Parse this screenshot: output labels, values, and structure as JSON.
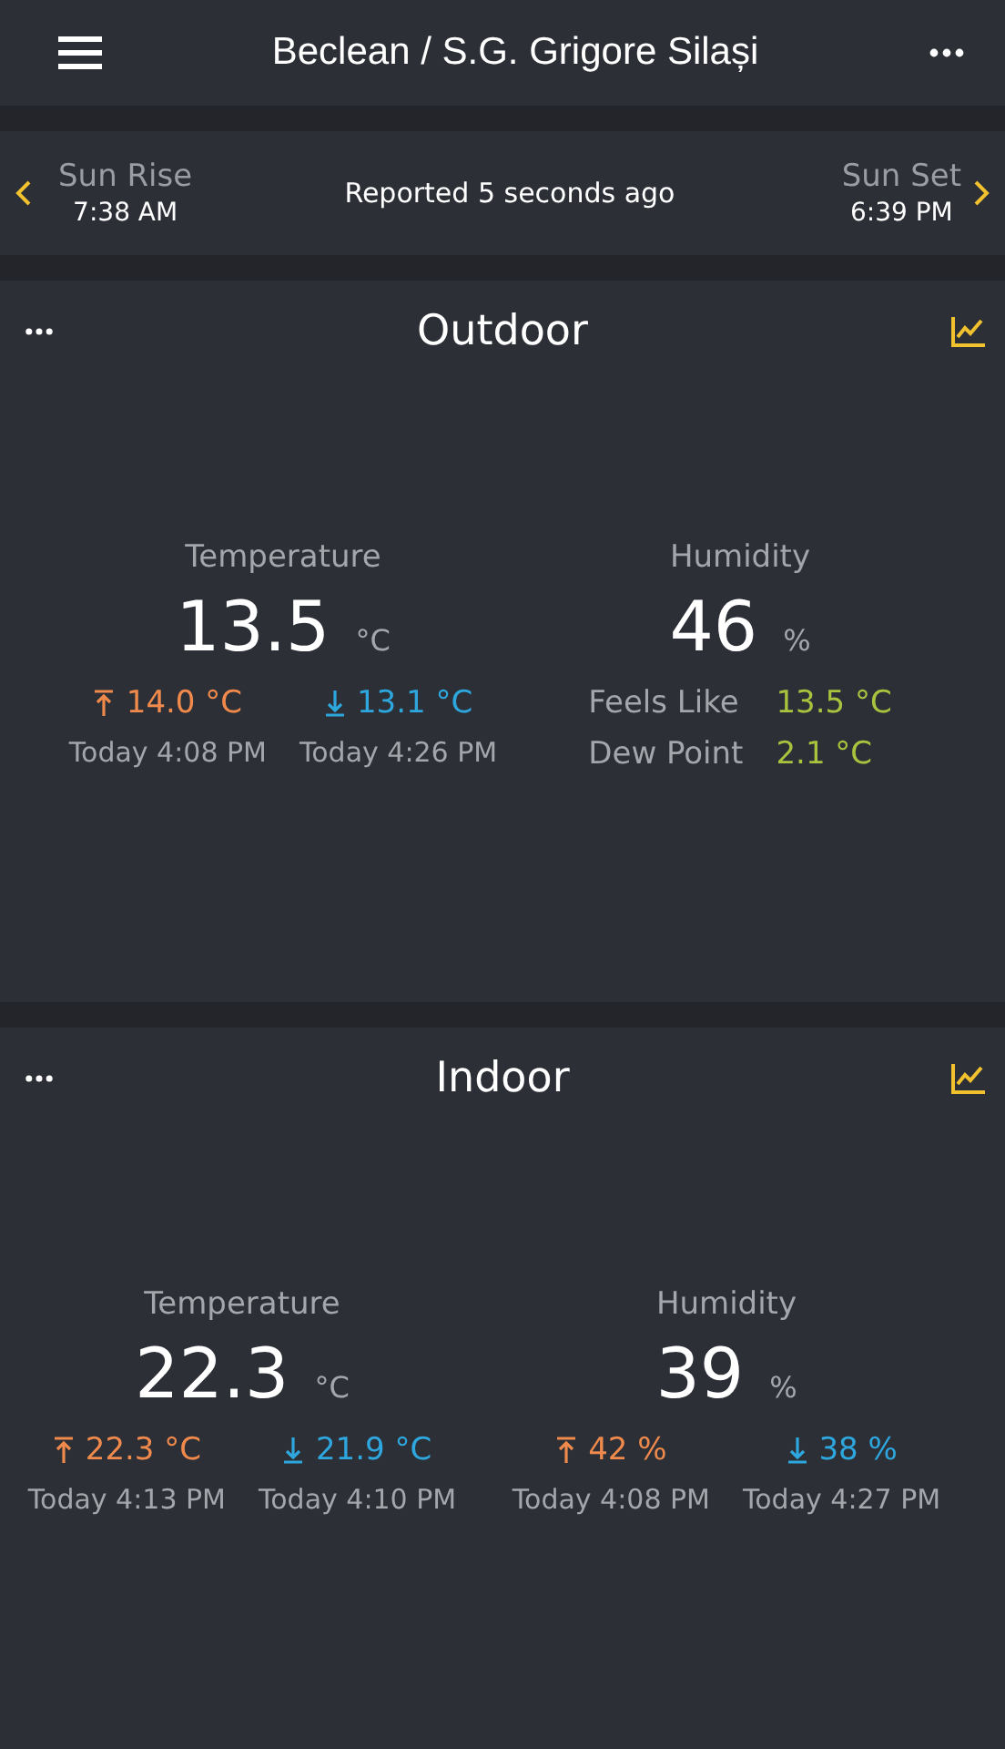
{
  "header": {
    "title": "Beclean / S.G. Grigore Silași"
  },
  "sun_bar": {
    "sunrise": {
      "label": "Sun Rise",
      "time": "7:38 AM"
    },
    "status": "Reported 5 seconds ago",
    "sunset": {
      "label": "Sun Set",
      "time": "6:39 PM"
    }
  },
  "panels": [
    {
      "title": "Outdoor",
      "metrics": [
        {
          "label": "Temperature",
          "value": "13.5",
          "unit": "°C",
          "kind": "extremes",
          "extremes": [
            {
              "kind": "high",
              "value": "14.0 °C",
              "time": "Today 4:08 PM"
            },
            {
              "kind": "low",
              "value": "13.1 °C",
              "time": "Today 4:26 PM"
            }
          ]
        },
        {
          "label": "Humidity",
          "value": "46",
          "unit": "%",
          "kind": "details",
          "details": [
            {
              "label": "Feels Like",
              "value": "13.5 °C"
            },
            {
              "label": "Dew Point",
              "value": "2.1 °C"
            }
          ]
        }
      ]
    },
    {
      "title": "Indoor",
      "metrics": [
        {
          "label": "Temperature",
          "value": "22.3",
          "unit": "°C",
          "kind": "extremes",
          "extremes": [
            {
              "kind": "high",
              "value": "22.3 °C",
              "time": "Today 4:13 PM"
            },
            {
              "kind": "low",
              "value": "21.9 °C",
              "time": "Today 4:10 PM"
            }
          ]
        },
        {
          "label": "Humidity",
          "value": "39",
          "unit": "%",
          "kind": "extremes",
          "extremes": [
            {
              "kind": "high",
              "value": "42 %",
              "time": "Today 4:08 PM"
            },
            {
              "kind": "low",
              "value": "38 %",
              "time": "Today 4:27 PM"
            }
          ]
        }
      ]
    }
  ]
}
